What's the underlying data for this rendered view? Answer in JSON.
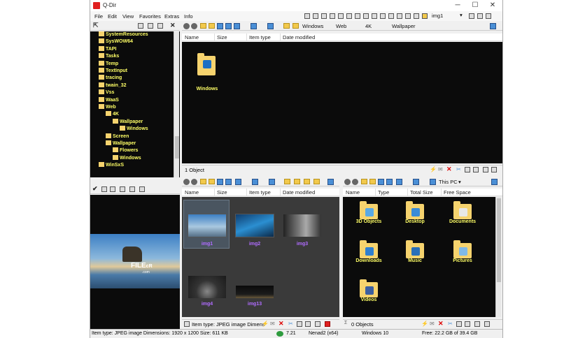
{
  "window": {
    "title": "Q-Dir",
    "minimize": "─",
    "maximize": "☐",
    "close": "✕"
  },
  "menu": [
    "File",
    "Edit",
    "View",
    "Favorites",
    "Extras",
    "Info"
  ],
  "toolbar": {
    "current_folder": "img1"
  },
  "tree": [
    {
      "label": "SystemResources",
      "indent": 0
    },
    {
      "label": "SysWOW64",
      "indent": 0
    },
    {
      "label": "TAPI",
      "indent": 0
    },
    {
      "label": "Tasks",
      "indent": 0
    },
    {
      "label": "Temp",
      "indent": 0
    },
    {
      "label": "TextInput",
      "indent": 0
    },
    {
      "label": "tracing",
      "indent": 0
    },
    {
      "label": "twain_32",
      "indent": 0
    },
    {
      "label": "Vss",
      "indent": 0
    },
    {
      "label": "WaaS",
      "indent": 0
    },
    {
      "label": "Web",
      "indent": 0
    },
    {
      "label": "4K",
      "indent": 1
    },
    {
      "label": "Wallpaper",
      "indent": 2
    },
    {
      "label": "Windows",
      "indent": 3
    },
    {
      "label": "Screen",
      "indent": 1
    },
    {
      "label": "Wallpaper",
      "indent": 1
    },
    {
      "label": "Flowers",
      "indent": 2
    },
    {
      "label": "Windows",
      "indent": 2
    },
    {
      "label": "WinSxS",
      "indent": 0
    }
  ],
  "preview": {
    "watermark": "FILE",
    "watermark_suffix": "cR",
    "watermark_sub": ".com"
  },
  "pane_top": {
    "breadcrumb": [
      "Windows",
      "Web",
      "4K",
      "Wallpaper"
    ],
    "columns": [
      "Name",
      "Size",
      "Item type",
      "Date modified"
    ],
    "items": [
      {
        "label": "Windows"
      }
    ],
    "status": "1 Object"
  },
  "pane_bl": {
    "columns": [
      "Name",
      "Size",
      "Item type",
      "Date modified"
    ],
    "items": [
      "img1",
      "img2",
      "img3",
      "img4",
      "img13"
    ],
    "status": "Item type: JPEG image Dimens"
  },
  "pane_br": {
    "breadcrumb": [
      "This PC"
    ],
    "columns": [
      "Name",
      "Type",
      "Total Size",
      "Free Space"
    ],
    "items": [
      "3D Objects",
      "Desktop",
      "Documents",
      "Downloads",
      "Music",
      "Pictures",
      "Videos"
    ],
    "status": "0 Objects",
    "location": "Windows 10",
    "free": "Free: 22.2 GB of 39.4 GB"
  },
  "statusbar": {
    "item_info": "Item type: JPEG image Dimensions: 1920 x 1200 Size: 611 KB",
    "version": "7.21",
    "user": "Nenad2 (x64)"
  },
  "colors": {
    "folder": "#f6d36e",
    "tree_text": "#ffff66",
    "file_text": "#b06cff",
    "pane_bg": "#0b0b0b"
  }
}
